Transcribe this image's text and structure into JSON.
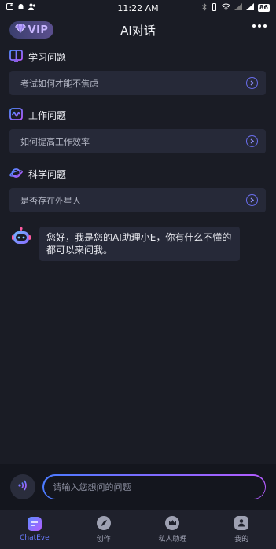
{
  "status_bar": {
    "time": "11:22 AM",
    "battery": "86"
  },
  "header": {
    "vip_label": "VIP",
    "title": "AI对话",
    "more_icon": "more-horizontal-icon"
  },
  "sections": [
    {
      "title": "学习问题",
      "icon": "book-icon",
      "question": "考试如何才能不焦虑"
    },
    {
      "title": "工作问题",
      "icon": "pulse-icon",
      "question": "如何提高工作效率"
    },
    {
      "title": "科学问题",
      "icon": "planet-icon",
      "question": "是否存在外星人"
    }
  ],
  "chat": {
    "bot_message": "您好，我是您的AI助理小E，你有什么不懂的都可以来问我。"
  },
  "input": {
    "placeholder": "请输入您想问的问题"
  },
  "tabs": [
    {
      "label": "ChatEve",
      "icon": "chat-icon",
      "active": true
    },
    {
      "label": "创作",
      "icon": "feather-icon",
      "active": false
    },
    {
      "label": "私人助理",
      "icon": "crown-icon",
      "active": false
    },
    {
      "label": "我的",
      "icon": "user-icon",
      "active": false
    }
  ],
  "colors": {
    "background": "#1a1c25",
    "card": "#262938",
    "accent": "#6a7cff",
    "accent_gradient_end": "#b45cff"
  }
}
